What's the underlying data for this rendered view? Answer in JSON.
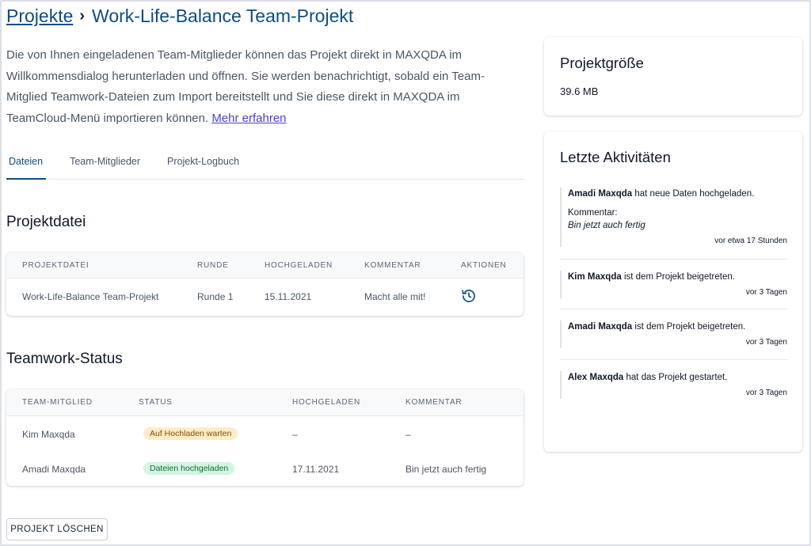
{
  "breadcrumb": {
    "parent": "Projekte",
    "separator": "›",
    "current": "Work-Life-Balance Team-Projekt"
  },
  "intro": {
    "text": "Die von Ihnen eingeladenen Team-Mitglieder können das Projekt direkt in MAXQDA im Willkommensdialog herunterladen und öffnen. Sie werden benachrichtigt, sobald ein Team-Mitglied Teamwork-Dateien zum Import bereitstellt und Sie diese direkt in MAXQDA im TeamCloud-Menü importieren können.",
    "link": "Mehr erfahren"
  },
  "tabs": [
    {
      "label": "Dateien",
      "active": true
    },
    {
      "label": "Team-Mitglieder",
      "active": false
    },
    {
      "label": "Projekt-Logbuch",
      "active": false
    }
  ],
  "projektdatei": {
    "title": "Projektdatei",
    "headers": [
      "Projektdatei",
      "Runde",
      "Hochgeladen",
      "Kommentar",
      "Aktionen"
    ],
    "rows": [
      {
        "file": "Work-Life-Balance Team-Projekt",
        "round": "Runde 1",
        "uploaded": "15.11.2021",
        "comment": "Macht alle mit!",
        "action_icon": "history-icon"
      }
    ]
  },
  "teamwork": {
    "title": "Teamwork-Status",
    "headers": [
      "Team-Mitglied",
      "Status",
      "Hochgeladen",
      "Kommentar"
    ],
    "rows": [
      {
        "member": "Kim Maxqda",
        "status": "Auf Hochladen warten",
        "status_color": "#fdecc8",
        "uploaded": "–",
        "comment": "–"
      },
      {
        "member": "Amadi Maxqda",
        "status": "Dateien hochgeladen",
        "status_color": "#d3f5e1",
        "uploaded": "17.11.2021",
        "comment": "Bin jetzt auch fertig"
      }
    ]
  },
  "delete_button": "PROJEKT LÖSCHEN",
  "size_panel": {
    "title": "Projektgröße",
    "value": "39.6 MB"
  },
  "activity_panel": {
    "title": "Letzte Aktivitäten",
    "items": [
      {
        "user": "Amadi Maxqda",
        "action": "hat neue Daten hochgeladen.",
        "comment_label": "Kommentar:",
        "comment": "Bin jetzt auch fertig",
        "time": "vor etwa 17 Stunden"
      },
      {
        "user": "Kim Maxqda",
        "action": "ist dem Projekt beigetreten.",
        "time": "vor 3 Tagen"
      },
      {
        "user": "Amadi Maxqda",
        "action": "ist dem Projekt beigetreten.",
        "time": "vor 3 Tagen"
      },
      {
        "user": "Alex Maxqda",
        "action": "hat das Projekt gestartet.",
        "time": "vor 3 Tagen"
      }
    ]
  },
  "colors": {
    "accent": "#0f4c81",
    "link": "#4b3fd8",
    "badge_wait": "#fdecc8",
    "badge_done": "#d3f5e1"
  }
}
